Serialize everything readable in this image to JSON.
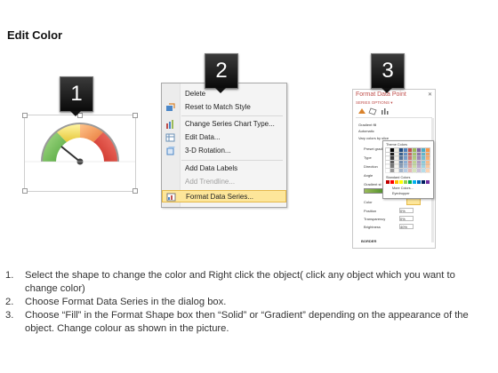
{
  "header": {
    "title": "Edit Color"
  },
  "steps": {
    "badges": [
      "1",
      "2",
      "3"
    ]
  },
  "context_menu": {
    "items": [
      {
        "label": "Delete",
        "icon": "delete-icon",
        "enabled": true
      },
      {
        "label": "Reset to Match Style",
        "icon": "reset-style-icon",
        "enabled": true
      },
      {
        "label": "Change Series Chart Type...",
        "icon": "chart-type-icon",
        "enabled": true
      },
      {
        "label": "Edit Data...",
        "icon": "edit-data-icon",
        "enabled": true
      },
      {
        "label": "3-D Rotation...",
        "icon": "rotation-3d-icon",
        "enabled": true
      },
      {
        "label": "Add Data Labels",
        "icon": "",
        "enabled": true
      },
      {
        "label": "Add Trendline...",
        "icon": "",
        "enabled": false
      },
      {
        "label": "Format Data Series...",
        "icon": "format-series-icon",
        "enabled": true,
        "highlighted": true
      }
    ]
  },
  "format_pane": {
    "title": "Format Data Point",
    "subtitle": "SERIES OPTIONS ▾",
    "rows": [
      {
        "label": "Gradient fill"
      },
      {
        "label": "Automatic"
      },
      {
        "label": "Vary colors by slice"
      },
      {
        "label": "Preset gradi"
      },
      {
        "label": "Type"
      },
      {
        "label": "Direction"
      },
      {
        "label": "Angle"
      },
      {
        "label": "Gradient st"
      },
      {
        "label": "Color"
      },
      {
        "label": "Position"
      },
      {
        "label": "Transparency"
      },
      {
        "label": "Brightness"
      }
    ],
    "values": [
      "0%",
      "0%",
      "40%"
    ],
    "border_label": "BORDER",
    "popup": {
      "theme_label": "Theme Colors",
      "standard_label": "Standard Colors",
      "more_label": "More Colors...",
      "eyedropper_label": "Eyedropper"
    }
  },
  "instructions": [
    {
      "num": "1.",
      "text": "Select the shape to change the color and Right click the object( click any object which you want to change color)"
    },
    {
      "num": "2.",
      "text": "Choose Format Data Series in the dialog box."
    },
    {
      "num": "3.",
      "text": "Choose “Fill” in the Format Shape box then “Solid” or “Gradient” depending on the appearance of the object. Change colour as shown in the picture."
    }
  ],
  "colors": {
    "accent": "#c0504d",
    "highlight": "#fde69a",
    "gauge_green": "#7ec36a",
    "gauge_yellow": "#f4e26a",
    "gauge_orange": "#f5a15c",
    "gauge_red": "#e0453c"
  }
}
